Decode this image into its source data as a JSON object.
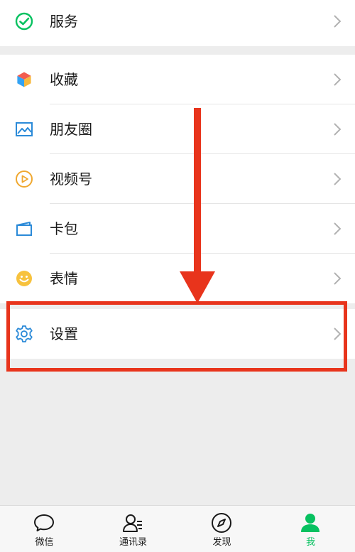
{
  "menu": {
    "service": {
      "label": "服务",
      "icon": "wechat-pay-icon"
    },
    "favorites": {
      "label": "收藏",
      "icon": "cube-icon"
    },
    "moments": {
      "label": "朋友圈",
      "icon": "image-icon"
    },
    "channels": {
      "label": "视频号",
      "icon": "play-icon"
    },
    "cards": {
      "label": "卡包",
      "icon": "wallet-icon"
    },
    "stickers": {
      "label": "表情",
      "icon": "smiley-icon"
    },
    "settings": {
      "label": "设置",
      "icon": "gear-icon"
    }
  },
  "tabbar": {
    "chats": {
      "label": "微信",
      "icon": "chat-bubble-icon"
    },
    "contacts": {
      "label": "通讯录",
      "icon": "contacts-icon"
    },
    "discover": {
      "label": "发现",
      "icon": "compass-icon"
    },
    "me": {
      "label": "我",
      "icon": "person-icon"
    }
  },
  "colors": {
    "accent_green": "#07c160",
    "annotation_red": "#e8341c"
  }
}
